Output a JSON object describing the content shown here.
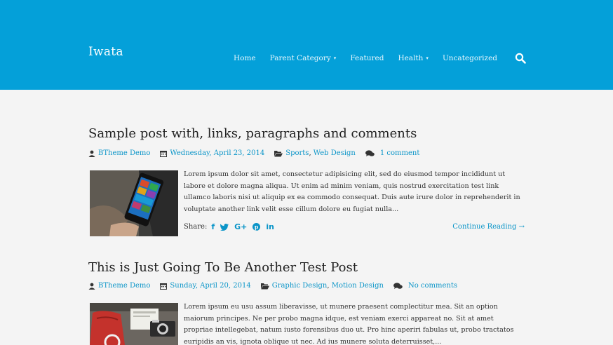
{
  "site": {
    "title": "Iwata"
  },
  "nav": {
    "items": [
      {
        "label": "Home"
      },
      {
        "label": "Parent Category",
        "caret": "▾"
      },
      {
        "label": "Featured"
      },
      {
        "label": "Health",
        "caret": "▾"
      },
      {
        "label": "Uncategorized"
      }
    ],
    "search_icon": "search-icon"
  },
  "posts": [
    {
      "title": "Sample post with, links, paragraphs and comments",
      "author": "BTheme Demo",
      "date": "Wednesday, April 23, 2014",
      "categories": [
        "Sports",
        "Web Design"
      ],
      "comments": "1 comment",
      "excerpt": "Lorem ipsum dolor sit amet, consectetur adipisicing elit, sed do eiusmod tempor incididunt ut labore et dolore magna aliqua. Ut enim ad minim veniam, quis nostrud exercitation test link ullamco laboris nisi ut aliquip ex ea commodo consequat. Duis aute irure dolor in reprehenderit in voluptate another link velit esse cillum dolore eu fugiat nulla...",
      "share_label": "Share:",
      "continue": "Continue Reading →"
    },
    {
      "title": "This is Just Going To Be Another Test Post",
      "author": "BTheme Demo",
      "date": "Sunday, April 20, 2014",
      "categories": [
        "Graphic Design",
        "Motion Design"
      ],
      "comments": "No comments",
      "excerpt": "Lorem ipsum eu usu assum liberavisse, ut munere praesent complectitur mea. Sit an option maiorum principes. Ne per probo magna idque, est veniam exerci appareat no. Sit at amet propriae intellegebat, natum iusto forensibus duo ut. Pro hinc aperiri fabulas ut, probo tractatos euripidis an vis, ignota oblique ut nec. Ad ius munere soluta deterruisset,..."
    }
  ],
  "colors": {
    "header": "#04a0d9",
    "link": "#0b95c8",
    "background": "#f4f4f4"
  }
}
